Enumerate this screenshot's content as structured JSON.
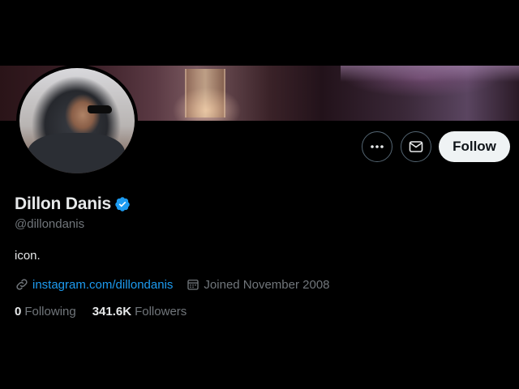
{
  "profile": {
    "display_name": "Dillon Danis",
    "handle": "@dillondanis",
    "bio": "icon.",
    "website": "instagram.com/dillondanis",
    "joined": "Joined November 2008",
    "verified": true
  },
  "actions": {
    "follow_label": "Follow",
    "more_icon": "more-icon",
    "message_icon": "envelope-icon"
  },
  "stats": {
    "following_count": "0",
    "following_label": "Following",
    "followers_count": "341.6K",
    "followers_label": "Followers"
  },
  "colors": {
    "background": "#000000",
    "link": "#1d9bf0",
    "secondary_text": "#71767b",
    "primary_text": "#e7e9ea",
    "verified_badge": "#1d9bf0",
    "follow_button_bg": "#eff3f4"
  }
}
